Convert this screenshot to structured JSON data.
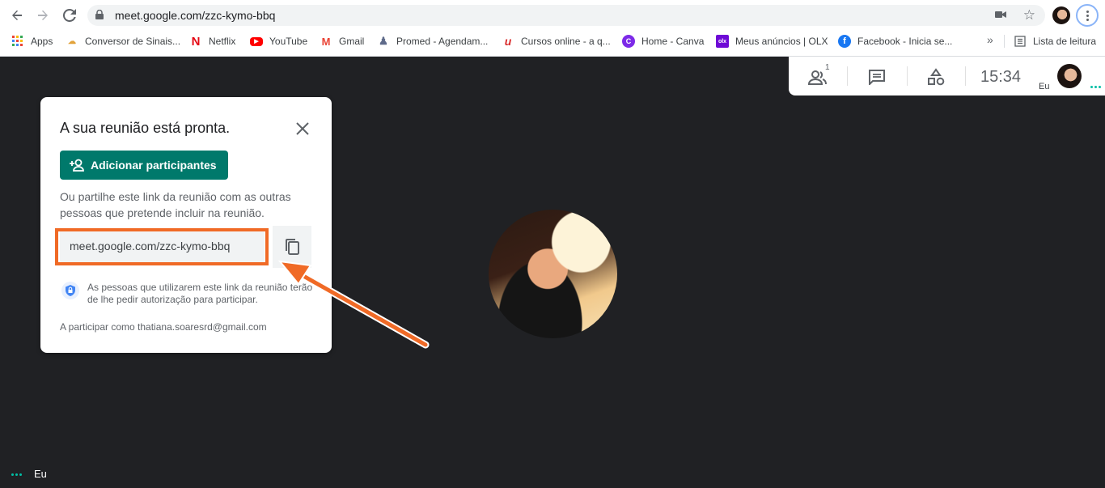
{
  "browser": {
    "url": "meet.google.com/zzc-kymo-bbq",
    "icons": {
      "back": "back-arrow-icon",
      "forward": "forward-arrow-icon",
      "reload": "reload-icon",
      "lock": "lock-icon",
      "camera": "camera-icon",
      "bookmark_star": "star-icon",
      "menu": "kebab-menu-icon"
    }
  },
  "bookmarks": {
    "items": [
      {
        "label": "Apps",
        "icon": "apps-grid-icon"
      },
      {
        "label": "Conversor de Sinais...",
        "icon": "conversor-icon"
      },
      {
        "label": "Netflix",
        "icon": "netflix-icon",
        "color": "#e50914"
      },
      {
        "label": "YouTube",
        "icon": "youtube-icon",
        "color": "#ff0000"
      },
      {
        "label": "Gmail",
        "icon": "gmail-icon",
        "color": "#ea4335"
      },
      {
        "label": "Promed - Agendam...",
        "icon": "promed-icon"
      },
      {
        "label": "Cursos online - a q...",
        "icon": "cursos-icon",
        "color": "#d92d2d"
      },
      {
        "label": "Home - Canva",
        "icon": "canva-icon",
        "color": "#7d2ae8"
      },
      {
        "label": "Meus anúncios | OLX",
        "icon": "olx-icon",
        "color": "#6e0ad6"
      },
      {
        "label": "Facebook - Inicia se...",
        "icon": "facebook-icon",
        "color": "#1877f2"
      }
    ],
    "more": "»",
    "reading_list": "Lista de leitura"
  },
  "meet_controls": {
    "people_count": "1",
    "time": "15:34",
    "self_label": "Eu"
  },
  "dialog": {
    "title": "A sua reunião está pronta.",
    "add_button": "Adicionar participantes",
    "description": "Ou partilhe este link da reunião com as outras pessoas que pretende incluir na reunião.",
    "link": "meet.google.com/zzc-kymo-bbq",
    "notice": "As pessoas que utilizarem este link da reunião terão de lhe pedir autorização para participar.",
    "joining_as": "A participar como thatiana.soaresrd@gmail.com"
  },
  "annotation": {
    "highlight_color": "#f06a26"
  },
  "bottom": {
    "self_label": "Eu"
  },
  "colors": {
    "meet_green": "#00796b",
    "background": "#202124"
  }
}
